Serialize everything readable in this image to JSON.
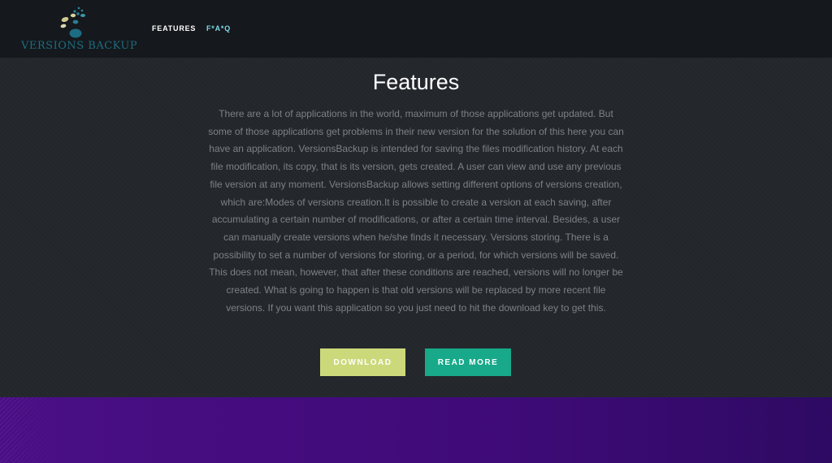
{
  "navbar": {
    "logo_text": "VERSIONS BACKUP",
    "links": [
      {
        "label": "FEATURES"
      },
      {
        "label": "F*A*Q"
      }
    ]
  },
  "main": {
    "title": "Features",
    "description": "There are a lot of applications in the world, maximum of those applications get updated. But some of those applications get problems in their new version for the solution of this here you can have an application. VersionsBackup is intended for saving the files modification history. At each file modification, its copy, that is its version, gets created. A user can view and use any previous file version at any moment. VersionsBackup allows setting different options of versions creation, which are:Modes of versions creation.It is possible to create a version at each saving, after accumulating a certain number of modifications, or after a certain time interval. Besides, a user can manually create versions when he/she finds it necessary. Versions storing. There is a possibility to set a number of versions for storing, or a period, for which versions will be saved. This does not mean, however, that after these conditions are reached, versions will no longer be created. What is going to happen is that old versions will be replaced by more recent file versions. If you want this application so you just need to hit the download key to get this.",
    "buttons": {
      "download_label": "DOWNLOAD",
      "read_more_label": "READ MORE"
    }
  },
  "colors": {
    "background": "#22262b",
    "navbar": "#15181c",
    "download_button": "#cbd97a",
    "read_more_button": "#17a98a",
    "footer": "#44108a"
  }
}
